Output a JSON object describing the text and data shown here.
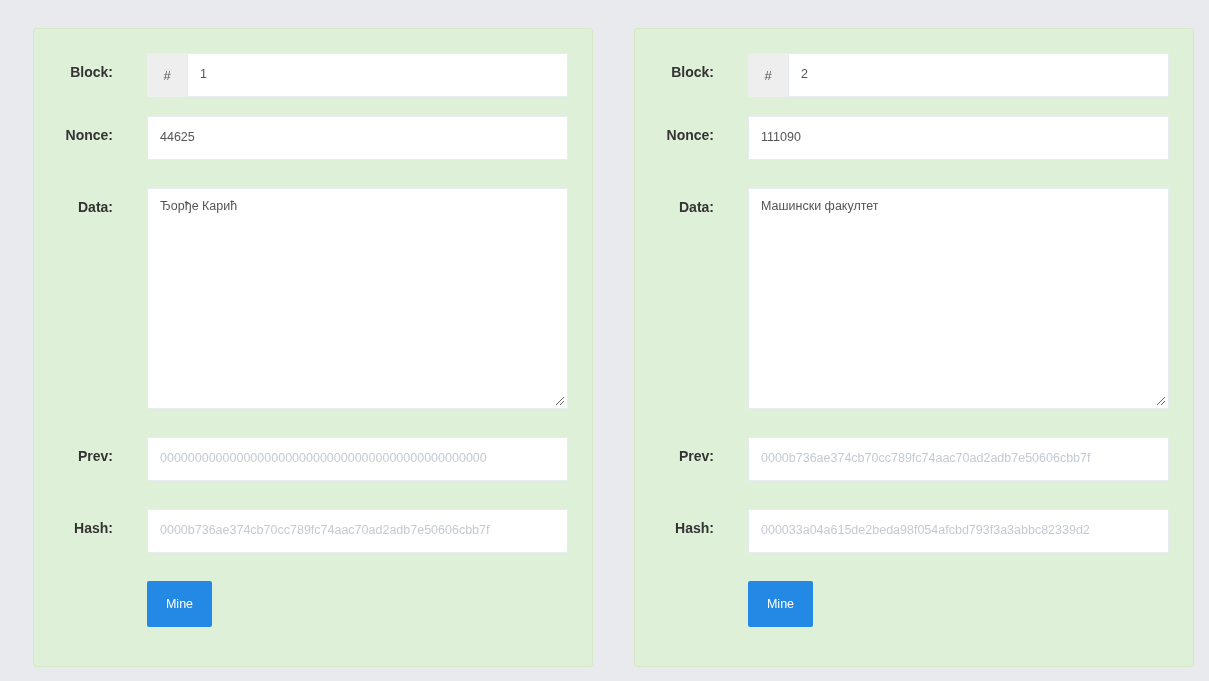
{
  "blocks": [
    {
      "block_label": "Block:",
      "block_prefix": "#",
      "block": "1",
      "nonce_label": "Nonce:",
      "nonce": "44625",
      "data_label": "Data:",
      "data": "Ђорђе Карић",
      "prev_label": "Prev:",
      "prev": "00000000000000000000000000000000000000000000000",
      "hash_label": "Hash:",
      "hash": "0000b736ae374cb70cc789fc74aac70ad2adb7e50606cbb7f",
      "button": "Mine"
    },
    {
      "block_label": "Block:",
      "block_prefix": "#",
      "block": "2",
      "nonce_label": "Nonce:",
      "nonce": "111090",
      "data_label": "Data:",
      "data": "Машински факултет",
      "prev_label": "Prev:",
      "prev": "0000b736ae374cb70cc789fc74aac70ad2adb7e50606cbb7f",
      "hash_label": "Hash:",
      "hash": "000033a04a615de2beda98f054afcbd793f3a3abbc82339d2",
      "button": "Mine"
    }
  ]
}
